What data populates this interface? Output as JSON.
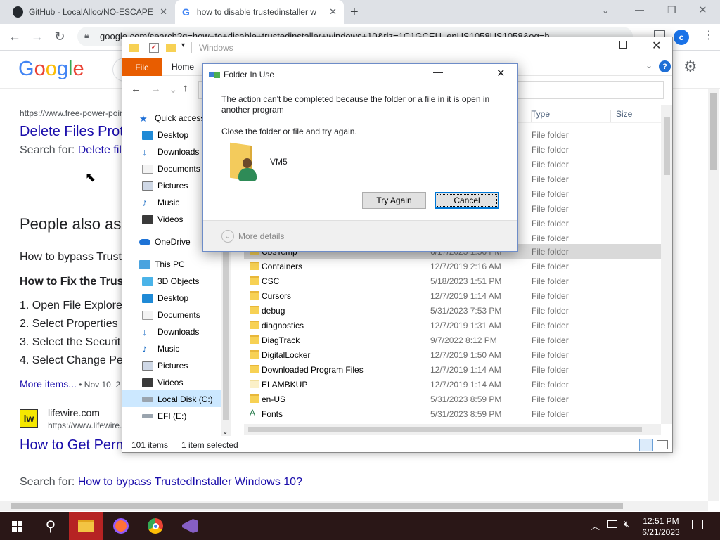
{
  "chrome": {
    "tabs": [
      {
        "title": "GitHub - LocalAlloc/NO-ESCAPE"
      },
      {
        "title": "how to disable trustedinstaller w"
      }
    ],
    "new_tab": "+",
    "url": "google.com/search?q=how+to+disable+trustedinstaller+windows+10&rlz=1C1GCEU_enUS1058US1058&oq=h",
    "profile_initial": "c"
  },
  "google": {
    "logo": [
      "G",
      "o",
      "o",
      "g",
      "l",
      "e"
    ],
    "result1": {
      "url": "https://www.free-power-poin",
      "title": "Delete Files Prot",
      "search_for_prefix": "Search for: ",
      "search_for_link": "Delete fil"
    },
    "people_also_ask": "People also as",
    "paa_q1": "How to bypass Trust",
    "paa_q2": "How to Fix the Trust",
    "steps": [
      "1. Open File Explore",
      "2. Select Properties",
      "3. Select the Securit",
      "4. Select Change Pe"
    ],
    "more_items": "More items...",
    "more_items_date": " • Nov 10, 2",
    "result2": {
      "site": "lifewire.com",
      "url": "https://www.lifewire.",
      "title": "How to Get Perm",
      "search_for_prefix": "Search for: ",
      "search_for_link": "How to bypass TrustedInstaller Windows 10?"
    }
  },
  "explorer": {
    "title": "Windows",
    "ribbon_tabs": [
      "File",
      "Home"
    ],
    "columns": {
      "type": "Type",
      "size": "Size"
    },
    "nav": {
      "quick_access": "Quick access",
      "qa_items": [
        "Desktop",
        "Downloads",
        "Documents",
        "Pictures",
        "Music",
        "Videos"
      ],
      "onedrive": "OneDrive",
      "this_pc": "This PC",
      "pc_items": [
        "3D Objects",
        "Desktop",
        "Documents",
        "Downloads",
        "Music",
        "Pictures",
        "Videos",
        "Local Disk (C:)",
        "EFI (E:)"
      ]
    },
    "hidden_type_rows": [
      "File folder",
      "File folder",
      "File folder",
      "File folder",
      "File folder",
      "File folder",
      "File folder",
      "File folder"
    ],
    "rows": [
      {
        "name": "CbsTemp",
        "date": "6/17/2023 1:56 PM",
        "type": "File folder"
      },
      {
        "name": "Containers",
        "date": "12/7/2019 2:16 AM",
        "type": "File folder"
      },
      {
        "name": "CSC",
        "date": "5/18/2023 1:51 PM",
        "type": "File folder"
      },
      {
        "name": "Cursors",
        "date": "12/7/2019 1:14 AM",
        "type": "File folder"
      },
      {
        "name": "debug",
        "date": "5/31/2023 7:53 PM",
        "type": "File folder"
      },
      {
        "name": "diagnostics",
        "date": "12/7/2019 1:31 AM",
        "type": "File folder"
      },
      {
        "name": "DiagTrack",
        "date": "9/7/2022 8:12 PM",
        "type": "File folder"
      },
      {
        "name": "DigitalLocker",
        "date": "12/7/2019 1:50 AM",
        "type": "File folder"
      },
      {
        "name": "Downloaded Program Files",
        "date": "12/7/2019 1:14 AM",
        "type": "File folder"
      },
      {
        "name": "ELAMBKUP",
        "date": "12/7/2019 1:14 AM",
        "type": "File folder"
      },
      {
        "name": "en-US",
        "date": "5/31/2023 8:59 PM",
        "type": "File folder"
      },
      {
        "name": "Fonts",
        "date": "5/31/2023 8:59 PM",
        "type": "File folder"
      }
    ],
    "status_items": "101 items",
    "status_selected": "1 item selected"
  },
  "dialog": {
    "title": "Folder In Use",
    "message": "The action can't be completed because the folder or a file in it is open in another program",
    "instruction": "Close the folder or file and try again.",
    "item_name": "VM5",
    "try_again": "Try Again",
    "cancel": "Cancel",
    "more_details": "More details"
  },
  "taskbar": {
    "time": "12:51 PM",
    "date": "6/21/2023"
  },
  "colors": {
    "file_tab": "#e85d00",
    "taskbar": "#2a1717",
    "link": "#1a0dab",
    "folder": "#f7d154"
  }
}
